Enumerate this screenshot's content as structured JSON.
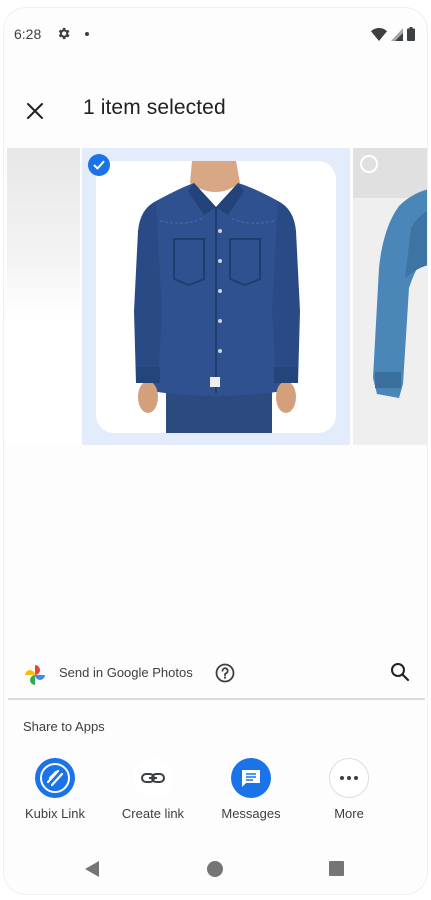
{
  "status_bar": {
    "time": "6:28",
    "icons": [
      "gear-icon",
      "notification-dot",
      "wifi-icon",
      "signal-icon",
      "battery-icon"
    ]
  },
  "header": {
    "close_icon": "close-icon",
    "title": "1 item selected"
  },
  "carousel": {
    "items": [
      {
        "name": "photo-left",
        "selected": false
      },
      {
        "name": "photo-denim-shirt",
        "selected": true
      },
      {
        "name": "photo-right",
        "selected": false
      }
    ],
    "accent": "#1a73e8",
    "selected_bg": "#e3ecfb"
  },
  "send_row": {
    "label": "Send in Google Photos",
    "help_icon": "help-circle-icon",
    "search_icon": "search-icon"
  },
  "share_section": {
    "label": "Share to Apps",
    "apps": [
      {
        "label": "Kubix Link",
        "icon": "kubix-link-icon",
        "color": "#1a73e8"
      },
      {
        "label": "Create link",
        "icon": "link-icon",
        "color": "#ffffff"
      },
      {
        "label": "Messages",
        "icon": "messages-icon",
        "color": "#1a73e8"
      },
      {
        "label": "More",
        "icon": "more-horizontal-icon",
        "color": "#ffffff"
      }
    ]
  },
  "nav_bar": {
    "icons": [
      "back-icon",
      "home-icon",
      "recents-icon"
    ]
  }
}
